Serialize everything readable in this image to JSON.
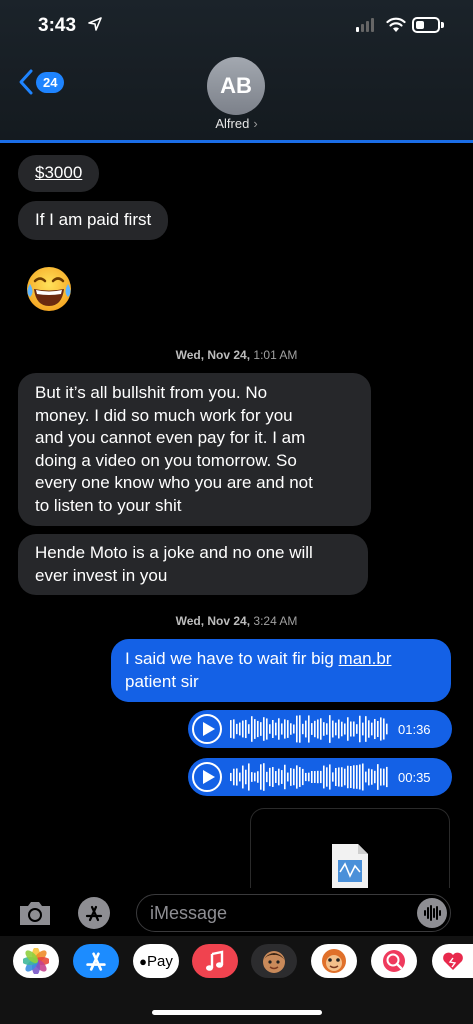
{
  "status": {
    "time": "3:43"
  },
  "header": {
    "back_count": "24",
    "avatar_initials": "AB",
    "contact_name": "Alfred",
    "chevron": "›"
  },
  "messages": {
    "m1": "$3000",
    "m2": "If I am paid first",
    "emoji": "😂",
    "ts1": {
      "day": "Wed, Nov 24,",
      "time": "1:01 AM"
    },
    "m3": [
      "But it’s all bullshit from you. No",
      "money. I did so much work for you",
      "and you cannot even pay for it. I am",
      "doing a video on you tomorrow. So",
      "every one know who you are and not",
      "to listen to your shit"
    ],
    "m4": [
      "Hende Moto is a joke and no one will",
      "ever invest in you"
    ],
    "ts2": {
      "day": "Wed, Nov 24,",
      "time": "3:24 AM"
    },
    "m5": {
      "line1_prefix": "I said we have to wait fir big ",
      "line1_link": "man.br",
      "line2": "patient sir"
    },
    "audio1": "01:36",
    "audio2": "00:35"
  },
  "input": {
    "placeholder": "iMessage"
  },
  "apps": [
    "photos",
    "app-store",
    "apple-pay",
    "music",
    "memoji",
    "animoji",
    "search-web",
    "digital-touch"
  ],
  "apple_pay_label": "Pay",
  "colors": {
    "blue_bubble": "#1461e6",
    "gray_bubble": "#26272a",
    "accent": "#1e84ff"
  }
}
